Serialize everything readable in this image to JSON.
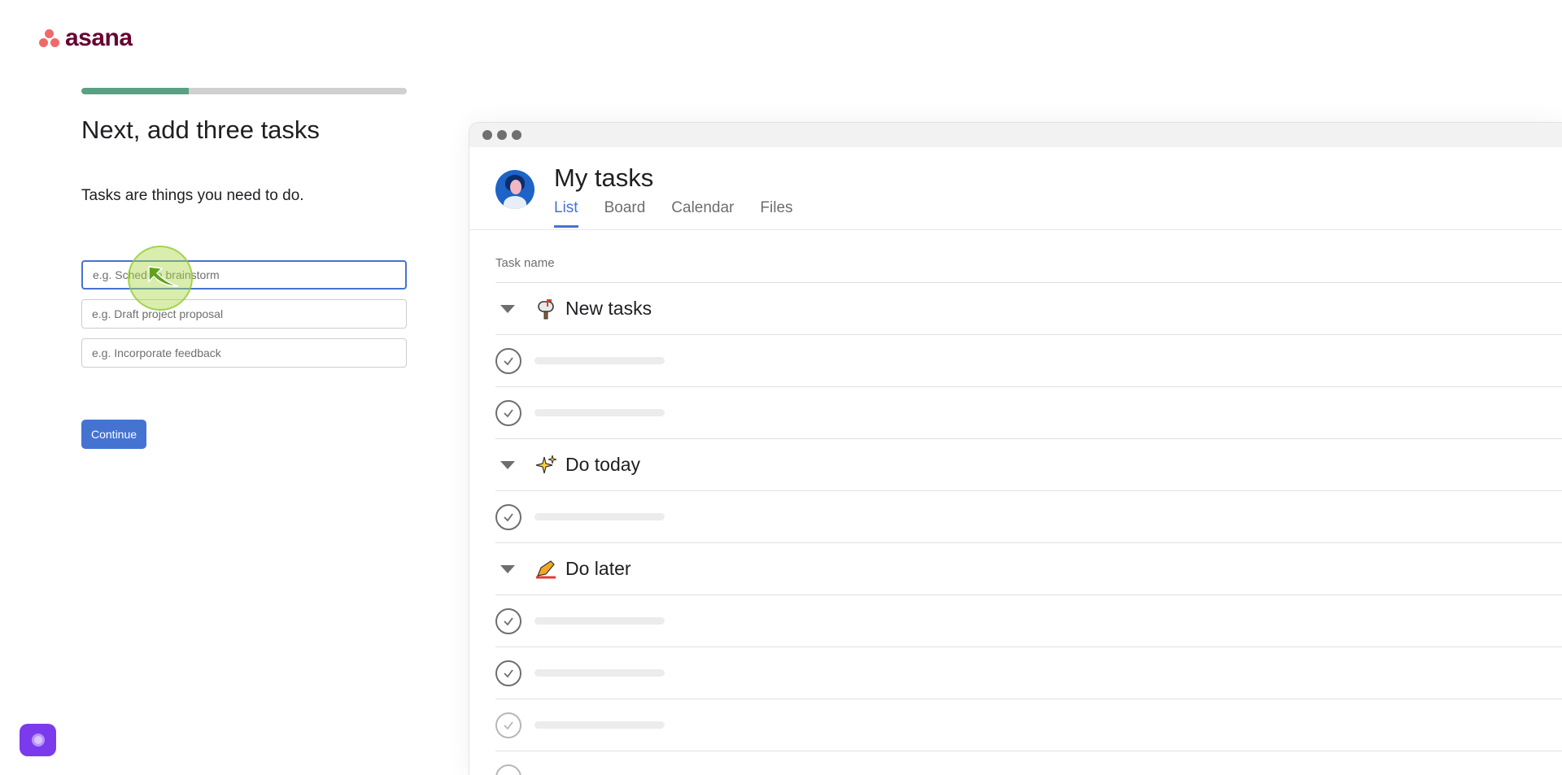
{
  "brand": {
    "name": "asana",
    "logo_color": "#690031",
    "dot_color": "#f06a6a"
  },
  "onboarding": {
    "progress_percent": 33,
    "title": "Next, add three tasks",
    "subtitle": "Tasks are things you need to do.",
    "inputs": [
      {
        "value": "",
        "placeholder": "e.g. Schedule brainstorm",
        "focused": true
      },
      {
        "value": "",
        "placeholder": "e.g. Draft project proposal",
        "focused": false
      },
      {
        "value": "",
        "placeholder": "e.g. Incorporate feedback",
        "focused": false
      }
    ],
    "continue_label": "Continue",
    "accent_color": "#4573d2",
    "progress_color": "#58a182"
  },
  "preview": {
    "title": "My tasks",
    "tabs": [
      {
        "label": "List",
        "active": true
      },
      {
        "label": "Board",
        "active": false
      },
      {
        "label": "Calendar",
        "active": false
      },
      {
        "label": "Files",
        "active": false
      }
    ],
    "column_header": "Task name",
    "sections": [
      {
        "label": "New tasks",
        "icon": "mailbox-icon",
        "task_count": 2
      },
      {
        "label": "Do today",
        "icon": "sparkles-icon",
        "task_count": 1
      },
      {
        "label": "Do later",
        "icon": "pencil-icon",
        "task_count": 3
      }
    ]
  },
  "help": {
    "icon": "chat-bubble-icon",
    "color": "#7c3aed"
  }
}
